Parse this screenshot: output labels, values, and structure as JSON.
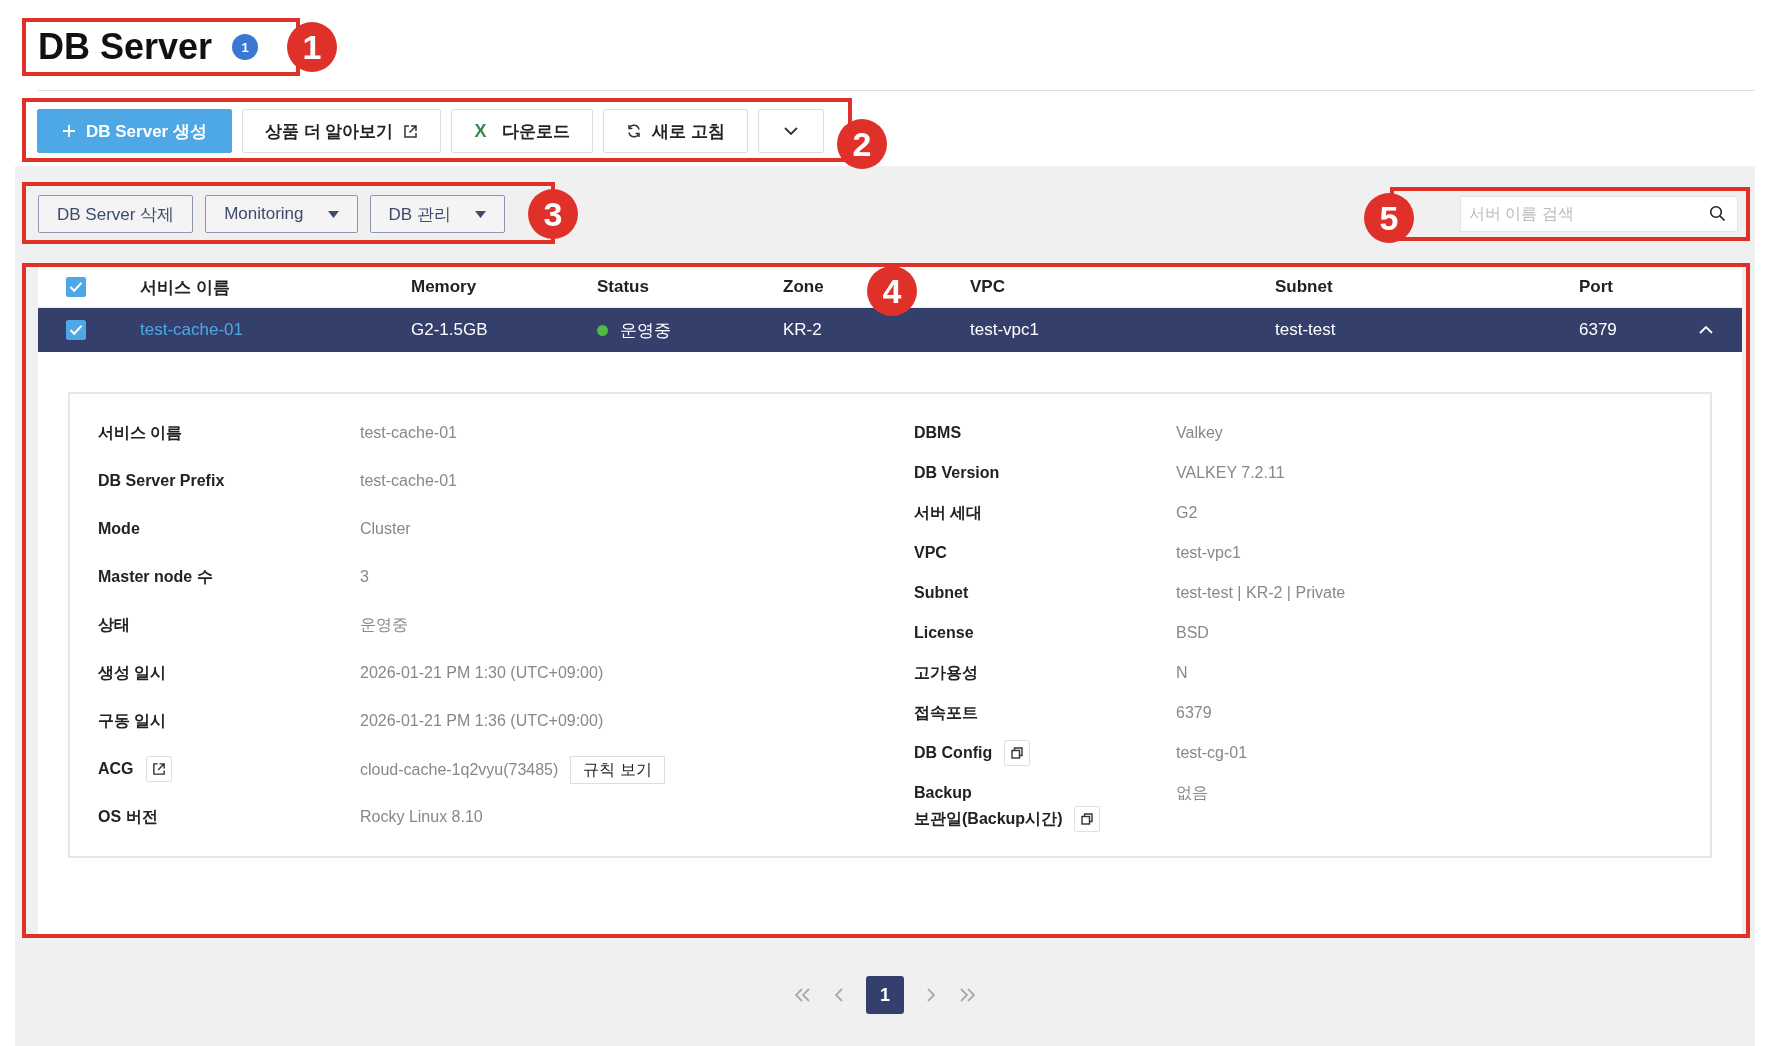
{
  "title": "DB Server",
  "title_badge": "1",
  "toolbar": [
    {
      "kind": "primary",
      "label": "DB Server 생성"
    },
    {
      "kind": "external",
      "label": "상품 더 알아보기"
    },
    {
      "kind": "excel",
      "label": "다운로드",
      "icon_text": "X"
    },
    {
      "kind": "refresh",
      "label": "새로 고침"
    },
    {
      "kind": "more"
    }
  ],
  "actions": [
    {
      "label": "DB Server 삭제",
      "dropdown": false
    },
    {
      "label": "Monitoring",
      "dropdown": true
    },
    {
      "label": "DB 관리",
      "dropdown": true
    }
  ],
  "search": {
    "placeholder": "서버 이름 검색"
  },
  "table": {
    "columns": [
      "서비스 이름",
      "Memory",
      "Status",
      "Zone",
      "VPC",
      "Subnet",
      "Port"
    ],
    "header_checked": true,
    "rows": [
      {
        "checked": true,
        "selected": true,
        "expanded": true,
        "color": "#4cbb3f",
        "cells": [
          "test-cache-01",
          "G2-1.5GB",
          "운영중",
          "KR-2",
          "test-vpc1",
          "test-test",
          "6379"
        ]
      }
    ]
  },
  "details": {
    "left": [
      {
        "label": "서비스 이름",
        "value": "test-cache-01"
      },
      {
        "label": "DB Server Prefix",
        "value": "test-cache-01"
      },
      {
        "label": "Mode",
        "value": "Cluster"
      },
      {
        "label": "Master node 수",
        "value": "3"
      },
      {
        "label": "상태",
        "value": "운영중"
      },
      {
        "label": "생성 일시",
        "value": "2026-01-21 PM 1:30 (UTC+09:00)"
      },
      {
        "label": "구동 일시",
        "value": "2026-01-21 PM 1:36 (UTC+09:00)"
      },
      {
        "label": "ACG",
        "value": "cloud-cache-1q2vyu(73485)",
        "kind": "link",
        "action": "규칙 보기"
      },
      {
        "label": "OS 버전",
        "value": "Rocky Linux 8.10"
      }
    ],
    "right": [
      {
        "label": "DBMS",
        "value": "Valkey"
      },
      {
        "label": "DB Version",
        "value": "VALKEY 7.2.11"
      },
      {
        "label": "서버 세대",
        "value": "G2"
      },
      {
        "label": "VPC",
        "value": "test-vpc1"
      },
      {
        "label": "Subnet",
        "value": "test-test | KR-2 | Private"
      },
      {
        "label": "License",
        "value": "BSD"
      },
      {
        "label": "고가용성",
        "value": "N"
      },
      {
        "label": "접속포트",
        "value": "6379"
      },
      {
        "label": "DB Config",
        "value": "test-cg-01",
        "kind": "copy"
      },
      {
        "label": "Backup\n보관일(Backup시간)",
        "value": "없음",
        "kind": "copy"
      }
    ]
  },
  "pagination": {
    "pages": [
      {
        "label": "1",
        "selected": true
      }
    ]
  },
  "annotations": [
    "1",
    "2",
    "3",
    "4",
    "5"
  ]
}
